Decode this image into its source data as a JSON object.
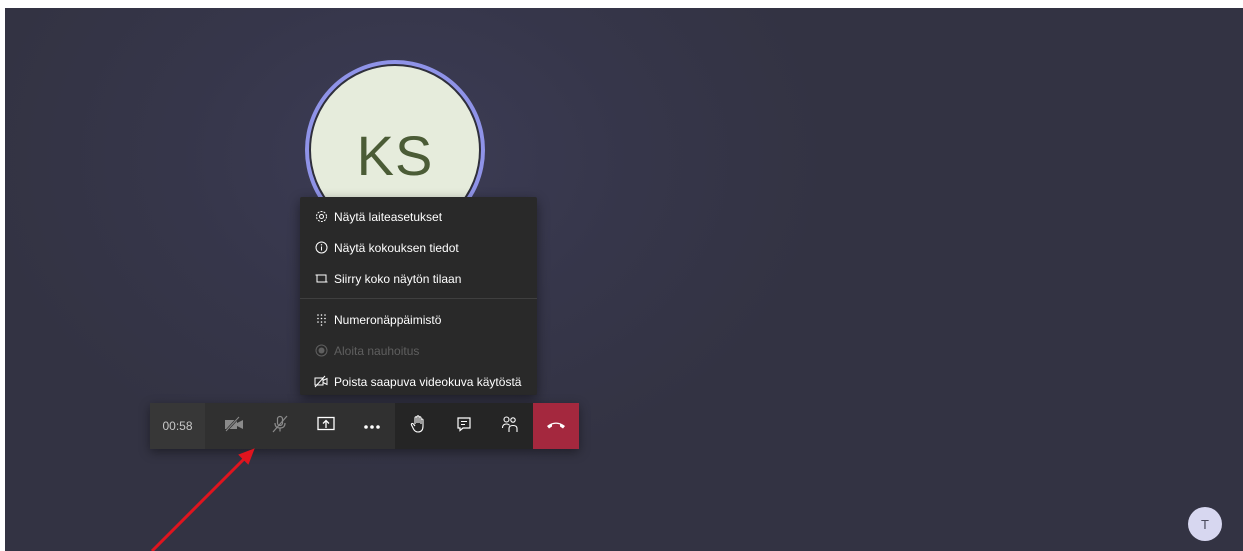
{
  "participant": {
    "initials": "KS"
  },
  "menu": {
    "items": [
      {
        "label": "Näytä laiteasetukset",
        "icon": "gear-icon",
        "disabled": false
      },
      {
        "label": "Näytä kokouksen tiedot",
        "icon": "info-icon",
        "disabled": false
      },
      {
        "label": "Siirry koko näytön tilaan",
        "icon": "fullscreen-icon",
        "disabled": false
      }
    ],
    "items2": [
      {
        "label": "Numeronäppäimistö",
        "icon": "keypad-icon",
        "disabled": false
      },
      {
        "label": "Aloita nauhoitus",
        "icon": "record-icon",
        "disabled": true
      },
      {
        "label": "Poista saapuva videokuva käytöstä",
        "icon": "video-off-icon",
        "disabled": false
      }
    ]
  },
  "toolbar": {
    "timer": "00:58",
    "buttons": [
      "camera-off-icon",
      "mic-off-icon",
      "share-screen-icon",
      "more-icon",
      "raise-hand-icon",
      "chat-icon",
      "participants-icon",
      "hangup-icon"
    ],
    "hangup_color": "#a4283e"
  },
  "user": {
    "initial": "T"
  },
  "colors": {
    "background": "#36364a",
    "menu_bg": "#292929",
    "avatar_ring": "#8f93e8",
    "avatar_fill": "#e6ecdc",
    "arrow": "#e0141e"
  }
}
